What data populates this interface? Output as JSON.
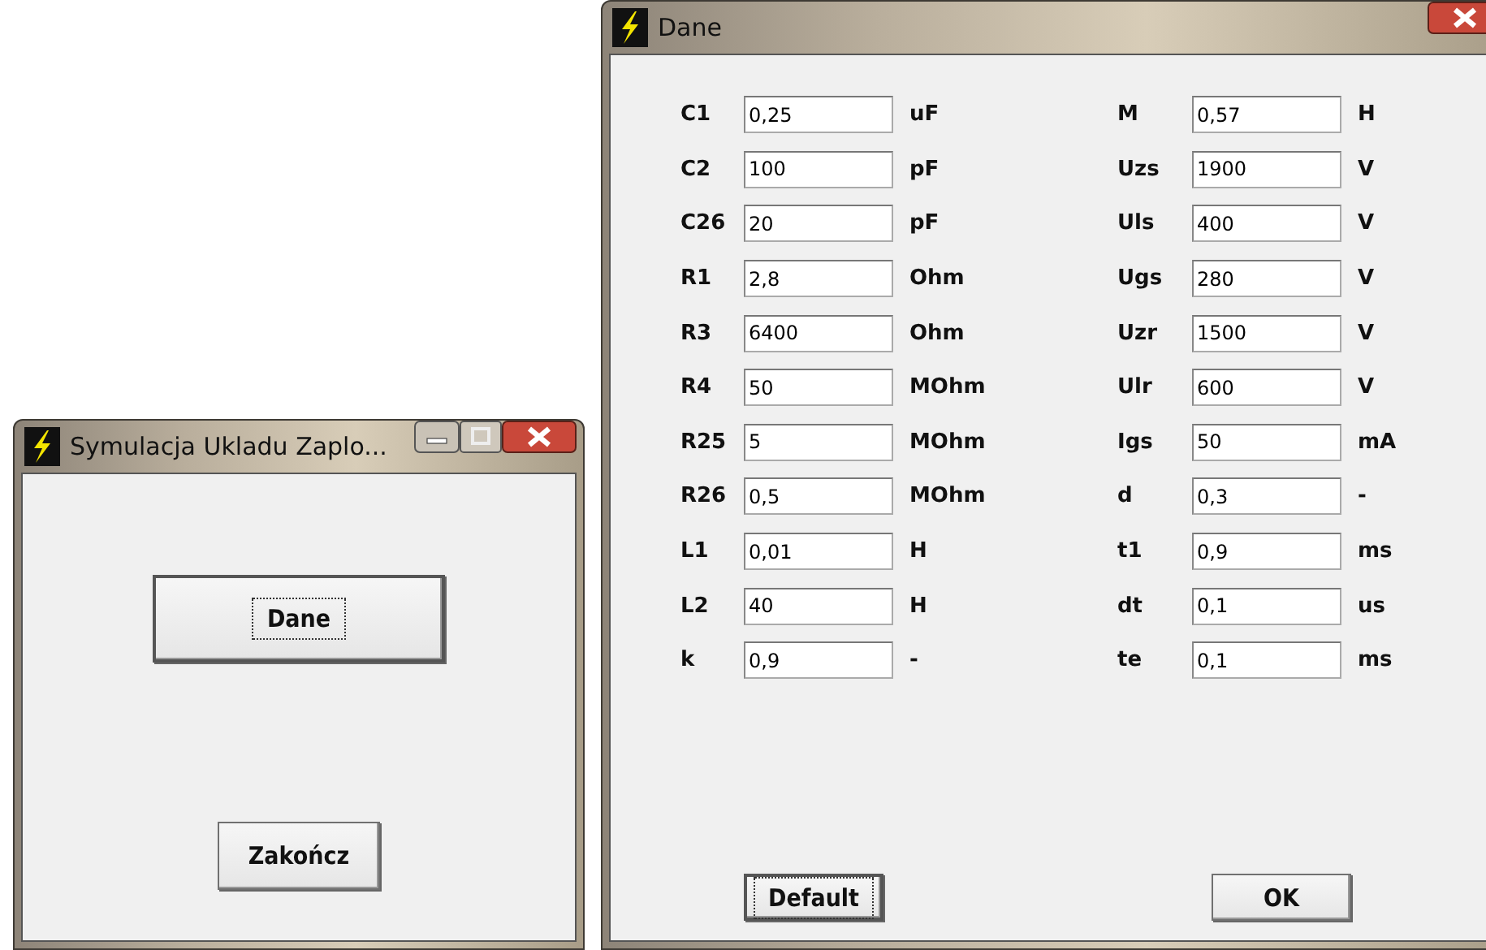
{
  "main_window": {
    "title": "Symulacja Ukladu Zaplo...",
    "buttons": [
      {
        "label": "Dane",
        "focused": true
      },
      {
        "label": "Zakończ",
        "focused": false
      }
    ]
  },
  "data_window": {
    "title": "Dane",
    "left_fields": [
      {
        "label": "C1",
        "value": "0,25",
        "unit": "uF"
      },
      {
        "label": "C2",
        "value": "100",
        "unit": "pF"
      },
      {
        "label": "C26",
        "value": "20",
        "unit": "pF"
      },
      {
        "label": "R1",
        "value": "2,8",
        "unit": "Ohm"
      },
      {
        "label": "R3",
        "value": "6400",
        "unit": "Ohm"
      },
      {
        "label": "R4",
        "value": "50",
        "unit": "MOhm"
      },
      {
        "label": "R25",
        "value": "5",
        "unit": "MOhm"
      },
      {
        "label": "R26",
        "value": "0,5",
        "unit": "MOhm"
      },
      {
        "label": "L1",
        "value": "0,01",
        "unit": "H"
      },
      {
        "label": "L2",
        "value": "40",
        "unit": "H"
      },
      {
        "label": "k",
        "value": "0,9",
        "unit": "-"
      }
    ],
    "right_fields": [
      {
        "label": "M",
        "value": "0,57",
        "unit": "H"
      },
      {
        "label": "Uzs",
        "value": "1900",
        "unit": "V"
      },
      {
        "label": "Uls",
        "value": "400",
        "unit": "V"
      },
      {
        "label": "Ugs",
        "value": "280",
        "unit": "V"
      },
      {
        "label": "Uzr",
        "value": "1500",
        "unit": "V"
      },
      {
        "label": "Ulr",
        "value": "600",
        "unit": "V"
      },
      {
        "label": "Igs",
        "value": "50",
        "unit": "mA"
      },
      {
        "label": "d",
        "value": "0,3",
        "unit": "-"
      },
      {
        "label": "t1",
        "value": "0,9",
        "unit": "ms"
      },
      {
        "label": "dt",
        "value": "0,1",
        "unit": "us"
      },
      {
        "label": "te",
        "value": "0,1",
        "unit": "ms"
      }
    ],
    "buttons": [
      {
        "label": "Default",
        "focused": true
      },
      {
        "label": "OK",
        "focused": false
      }
    ]
  }
}
